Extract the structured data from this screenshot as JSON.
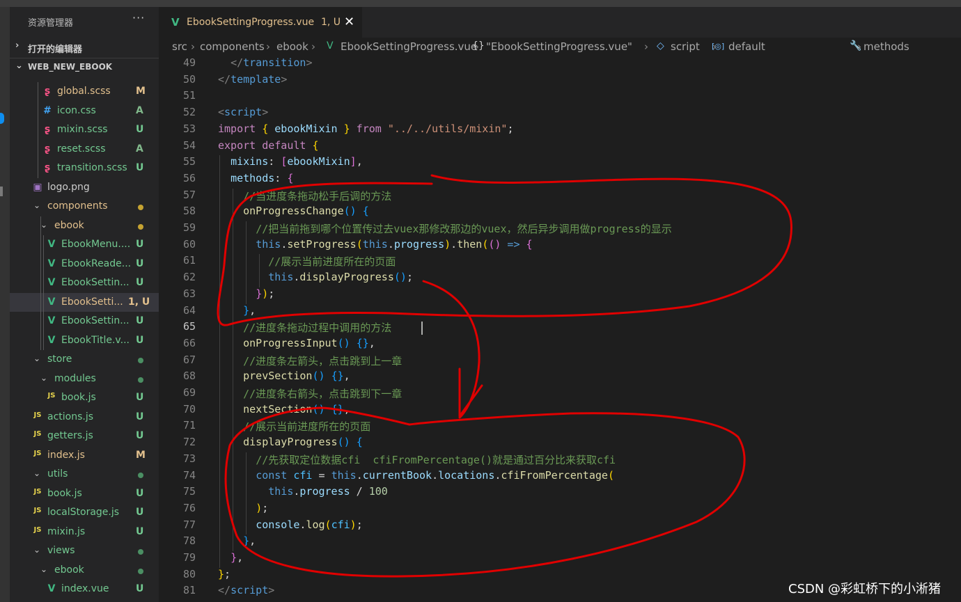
{
  "explorer": {
    "title": "资源管理器",
    "more": "···",
    "open_editors": "打开的编辑器",
    "root": "WEB_NEW_EBOOK",
    "items": [
      {
        "icon": "sass-icon",
        "name": "global.scss",
        "status": "M"
      },
      {
        "icon": "css-icon",
        "name": "icon.css",
        "status": "A"
      },
      {
        "icon": "sass-icon",
        "name": "mixin.scss",
        "status": "U"
      },
      {
        "icon": "sass-icon",
        "name": "reset.scss",
        "status": "A"
      },
      {
        "icon": "sass-icon",
        "name": "transition.scss",
        "status": "U"
      },
      {
        "icon": "image-icon",
        "name": "logo.png",
        "status": ""
      },
      {
        "icon": "folder-open-chevron",
        "name": "components",
        "status": "●"
      },
      {
        "icon": "folder-open-chevron",
        "name": "ebook",
        "status": "●"
      },
      {
        "icon": "vue-icon",
        "name": "EbookMenu....",
        "status": "U"
      },
      {
        "icon": "vue-icon",
        "name": "EbookReade...",
        "status": "U"
      },
      {
        "icon": "vue-icon",
        "name": "EbookSettin...",
        "status": "U"
      },
      {
        "icon": "vue-icon",
        "name": "EbookSetti...",
        "status": "1, U"
      },
      {
        "icon": "vue-icon",
        "name": "EbookSettin...",
        "status": "U"
      },
      {
        "icon": "vue-icon",
        "name": "EbookTitle.v...",
        "status": "U"
      },
      {
        "icon": "folder-open-chevron",
        "name": "store",
        "status": "●"
      },
      {
        "icon": "folder-open-chevron",
        "name": "modules",
        "status": "●"
      },
      {
        "icon": "js-icon",
        "name": "book.js",
        "status": "U"
      },
      {
        "icon": "js-icon",
        "name": "actions.js",
        "status": "U"
      },
      {
        "icon": "js-icon",
        "name": "getters.js",
        "status": "U"
      },
      {
        "icon": "js-icon",
        "name": "index.js",
        "status": "M"
      },
      {
        "icon": "folder-open-chevron",
        "name": "utils",
        "status": "●"
      },
      {
        "icon": "js-icon",
        "name": "book.js",
        "status": "U"
      },
      {
        "icon": "js-icon",
        "name": "localStorage.js",
        "status": "U"
      },
      {
        "icon": "js-icon",
        "name": "mixin.js",
        "status": "U"
      },
      {
        "icon": "folder-open-chevron",
        "name": "views",
        "status": "●"
      },
      {
        "icon": "folder-open-chevron",
        "name": "ebook",
        "status": "●"
      },
      {
        "icon": "vue-icon",
        "name": "index.vue",
        "status": "U"
      }
    ]
  },
  "tab": {
    "name": "EbookSettingProgress.vue",
    "status": "1, U",
    "close": "✕"
  },
  "breadcrumb": [
    "src",
    "components",
    "ebook",
    "EbookSettingProgress.vue",
    "\"EbookSettingProgress.vue\"",
    "script",
    "default",
    "methods"
  ],
  "editor": {
    "current_line": 65,
    "line_numbers": [
      49,
      50,
      51,
      52,
      53,
      54,
      55,
      56,
      57,
      58,
      59,
      60,
      61,
      62,
      63,
      64,
      65,
      66,
      67,
      68,
      69,
      70,
      71,
      72,
      73,
      74,
      75,
      76,
      77,
      78,
      79,
      80,
      81
    ],
    "lines": [
      [
        {
          "t": "  ",
          "c": ""
        },
        {
          "t": "</",
          "c": "tg"
        },
        {
          "t": "transition",
          "c": "tn"
        },
        {
          "t": ">",
          "c": "tg"
        }
      ],
      [
        {
          "t": "</",
          "c": "tg"
        },
        {
          "t": "template",
          "c": "tn"
        },
        {
          "t": ">",
          "c": "tg"
        }
      ],
      [],
      [
        {
          "t": "<",
          "c": "tg"
        },
        {
          "t": "script",
          "c": "tn"
        },
        {
          "t": ">",
          "c": "tg"
        }
      ],
      [
        {
          "t": "import ",
          "c": "kw"
        },
        {
          "t": "{ ",
          "c": "b1"
        },
        {
          "t": "ebookMixin",
          "c": "vr"
        },
        {
          "t": " }",
          "c": "b1"
        },
        {
          "t": " from ",
          "c": "kw"
        },
        {
          "t": "\"../../utils/mixin\"",
          "c": "st"
        },
        {
          "t": ";",
          "c": ""
        }
      ],
      [
        {
          "t": "export default ",
          "c": "kw"
        },
        {
          "t": "{",
          "c": "b1"
        }
      ],
      [
        {
          "t": "  ",
          "c": ""
        },
        {
          "t": "mixins",
          "c": "vr"
        },
        {
          "t": ": ",
          "c": ""
        },
        {
          "t": "[",
          "c": "b2"
        },
        {
          "t": "ebookMixin",
          "c": "vr"
        },
        {
          "t": "]",
          "c": "b2"
        },
        {
          "t": ",",
          "c": ""
        }
      ],
      [
        {
          "t": "  ",
          "c": ""
        },
        {
          "t": "methods",
          "c": "vr"
        },
        {
          "t": ": ",
          "c": ""
        },
        {
          "t": "{",
          "c": "b2"
        }
      ],
      [
        {
          "t": "    ",
          "c": ""
        },
        {
          "t": "//当进度条拖动松手后调的方法",
          "c": "cm"
        }
      ],
      [
        {
          "t": "    ",
          "c": ""
        },
        {
          "t": "onProgressChange",
          "c": "fn"
        },
        {
          "t": "() ",
          "c": "b3"
        },
        {
          "t": "{",
          "c": "b3"
        }
      ],
      [
        {
          "t": "      ",
          "c": ""
        },
        {
          "t": "//把当前拖到哪个位置传过去vuex那修改那边的vuex，然后异步调用做progress的显示",
          "c": "cm"
        }
      ],
      [
        {
          "t": "      ",
          "c": ""
        },
        {
          "t": "this",
          "c": "th"
        },
        {
          "t": ".",
          "c": ""
        },
        {
          "t": "setProgress",
          "c": "fn"
        },
        {
          "t": "(",
          "c": "b1"
        },
        {
          "t": "this",
          "c": "th"
        },
        {
          "t": ".",
          "c": ""
        },
        {
          "t": "progress",
          "c": "vr"
        },
        {
          "t": ")",
          "c": "b1"
        },
        {
          "t": ".",
          "c": ""
        },
        {
          "t": "then",
          "c": "fn"
        },
        {
          "t": "(",
          "c": "b1"
        },
        {
          "t": "()",
          "c": "b2"
        },
        {
          "t": " => ",
          "c": "th"
        },
        {
          "t": "{",
          "c": "b2"
        }
      ],
      [
        {
          "t": "        ",
          "c": ""
        },
        {
          "t": "//展示当前进度所在的页面",
          "c": "cm"
        }
      ],
      [
        {
          "t": "        ",
          "c": ""
        },
        {
          "t": "this",
          "c": "th"
        },
        {
          "t": ".",
          "c": ""
        },
        {
          "t": "displayProgress",
          "c": "fn"
        },
        {
          "t": "()",
          "c": "b3"
        },
        {
          "t": ";",
          "c": ""
        }
      ],
      [
        {
          "t": "      ",
          "c": ""
        },
        {
          "t": "}",
          "c": "b2"
        },
        {
          "t": ")",
          "c": "b1"
        },
        {
          "t": ";",
          "c": ""
        }
      ],
      [
        {
          "t": "    ",
          "c": ""
        },
        {
          "t": "}",
          "c": "b3"
        },
        {
          "t": ",",
          "c": ""
        }
      ],
      [
        {
          "t": "    ",
          "c": ""
        },
        {
          "t": "//进度条拖动过程中调用的方法",
          "c": "cm"
        }
      ],
      [
        {
          "t": "    ",
          "c": ""
        },
        {
          "t": "onProgressInput",
          "c": "fn"
        },
        {
          "t": "() ",
          "c": "b3"
        },
        {
          "t": "{}",
          "c": "b3"
        },
        {
          "t": ",",
          "c": ""
        }
      ],
      [
        {
          "t": "    ",
          "c": ""
        },
        {
          "t": "//进度条左箭头，点击跳到上一章",
          "c": "cm"
        }
      ],
      [
        {
          "t": "    ",
          "c": ""
        },
        {
          "t": "prevSection",
          "c": "fn"
        },
        {
          "t": "() ",
          "c": "b3"
        },
        {
          "t": "{}",
          "c": "b3"
        },
        {
          "t": ",",
          "c": ""
        }
      ],
      [
        {
          "t": "    ",
          "c": ""
        },
        {
          "t": "//进度条右箭头，点击跳到下一章",
          "c": "cm"
        }
      ],
      [
        {
          "t": "    ",
          "c": ""
        },
        {
          "t": "nextSection",
          "c": "fn"
        },
        {
          "t": "() ",
          "c": "b3"
        },
        {
          "t": "{}",
          "c": "b3"
        },
        {
          "t": ",",
          "c": ""
        }
      ],
      [
        {
          "t": "    ",
          "c": ""
        },
        {
          "t": "//展示当前进度所在的页面",
          "c": "cm"
        }
      ],
      [
        {
          "t": "    ",
          "c": ""
        },
        {
          "t": "displayProgress",
          "c": "fn"
        },
        {
          "t": "() ",
          "c": "b3"
        },
        {
          "t": "{",
          "c": "b3"
        }
      ],
      [
        {
          "t": "      ",
          "c": ""
        },
        {
          "t": "//先获取定位数据cfi  cfiFromPercentage()就是通过百分比来获取cfi",
          "c": "cm"
        }
      ],
      [
        {
          "t": "      ",
          "c": ""
        },
        {
          "t": "const ",
          "c": "th"
        },
        {
          "t": "cfi",
          "c": "cn"
        },
        {
          "t": " = ",
          "c": ""
        },
        {
          "t": "this",
          "c": "th"
        },
        {
          "t": ".",
          "c": ""
        },
        {
          "t": "currentBook",
          "c": "vr"
        },
        {
          "t": ".",
          "c": ""
        },
        {
          "t": "locations",
          "c": "vr"
        },
        {
          "t": ".",
          "c": ""
        },
        {
          "t": "cfiFromPercentage",
          "c": "fn"
        },
        {
          "t": "(",
          "c": "b1"
        }
      ],
      [
        {
          "t": "        ",
          "c": ""
        },
        {
          "t": "this",
          "c": "th"
        },
        {
          "t": ".",
          "c": ""
        },
        {
          "t": "progress",
          "c": "vr"
        },
        {
          "t": " / ",
          "c": ""
        },
        {
          "t": "100",
          "c": "nm"
        }
      ],
      [
        {
          "t": "      ",
          "c": ""
        },
        {
          "t": ")",
          "c": "b1"
        },
        {
          "t": ";",
          "c": ""
        }
      ],
      [
        {
          "t": "      ",
          "c": ""
        },
        {
          "t": "console",
          "c": "vr"
        },
        {
          "t": ".",
          "c": ""
        },
        {
          "t": "log",
          "c": "fn"
        },
        {
          "t": "(",
          "c": "b1"
        },
        {
          "t": "cfi",
          "c": "cn"
        },
        {
          "t": ")",
          "c": "b1"
        },
        {
          "t": ";",
          "c": ""
        }
      ],
      [
        {
          "t": "    ",
          "c": ""
        },
        {
          "t": "}",
          "c": "b3"
        },
        {
          "t": ",",
          "c": ""
        }
      ],
      [
        {
          "t": "  ",
          "c": ""
        },
        {
          "t": "}",
          "c": "b2"
        },
        {
          "t": ",",
          "c": ""
        }
      ],
      [
        {
          "t": "}",
          "c": "b1"
        },
        {
          "t": ";",
          "c": ""
        }
      ],
      [
        {
          "t": "</",
          "c": "tg"
        },
        {
          "t": "script",
          "c": "tn"
        },
        {
          "t": ">",
          "c": "tg"
        }
      ]
    ]
  },
  "watermark": "CSDN @彩虹桥下的小淅猪",
  "colors": {
    "status_U": "#73c991",
    "status_M": "#e2c08d",
    "status_A": "#81b88b",
    "folder_dot": "#73c991",
    "folder_dot_mod": "#c5a332",
    "annotation": "#e00000"
  }
}
